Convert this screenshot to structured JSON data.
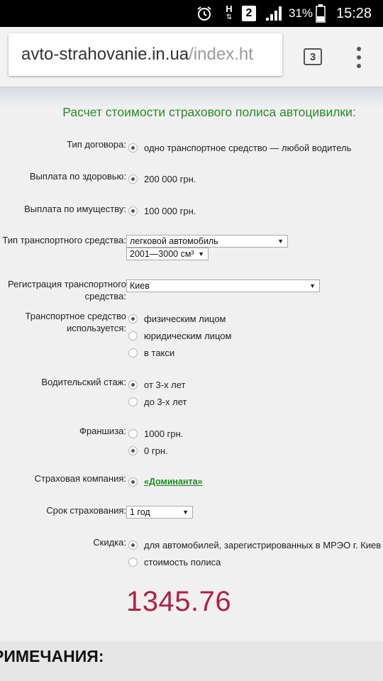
{
  "status_bar": {
    "alarm_icon": "alarm-clock-icon",
    "network_label": "H",
    "sim_badge": "2",
    "signal_icon": "signal-bars-icon",
    "battery_percent": "31%",
    "battery_icon": "battery-icon",
    "time": "15:28"
  },
  "browser": {
    "url_host": "avto-strahovanie.in.ua",
    "url_path": "/index.ht",
    "tab_count": "3",
    "menu_icon": "overflow-menu-icon"
  },
  "form": {
    "title": "Расчет стоимости страхового полиса автоцивилки:",
    "contract_type": {
      "label": "Тип договора:",
      "options": [
        "одно транспортное средство — любой водитель"
      ],
      "selected_index": 0
    },
    "health_payout": {
      "label": "Выплата по здоровью:",
      "options": [
        "200 000 грн."
      ],
      "selected_index": 0
    },
    "property_payout": {
      "label": "Выплата по имуществу:",
      "options": [
        "100 000 грн."
      ],
      "selected_index": 0
    },
    "vehicle_type": {
      "label": "Тип транспортного средства:",
      "selected": "легковой автомобиль",
      "engine_selected": "2001—3000 см³"
    },
    "registration": {
      "label_line1": "Регистрация транспортного",
      "label_line2": "средства:",
      "selected": "Киев"
    },
    "usage": {
      "label_line1": "Транспортное средство",
      "label_line2": "используется:",
      "options": [
        "физическим лицом",
        "юридическим лицом",
        "в такси"
      ],
      "selected_index": 0
    },
    "experience": {
      "label": "Водительский стаж:",
      "options": [
        "от 3-х лет",
        "до 3-х лет"
      ],
      "selected_index": 0
    },
    "franchise": {
      "label": "Франшиза:",
      "options": [
        "1000 грн.",
        "0 грн."
      ],
      "selected_index": 1
    },
    "insurer": {
      "label": "Страховая компания:",
      "link": "«Доминанта»"
    },
    "term": {
      "label": "Срок страхования:",
      "selected": "1 год"
    },
    "discount": {
      "label": "Скидка:",
      "options": [
        "для автомобилей, зарегистрированных в МРЭО г. Киев",
        "стоимость полиса"
      ],
      "selected_index": 0
    },
    "price": "1345.76"
  },
  "notes": {
    "title": "РИМЕЧАНИЯ:"
  }
}
